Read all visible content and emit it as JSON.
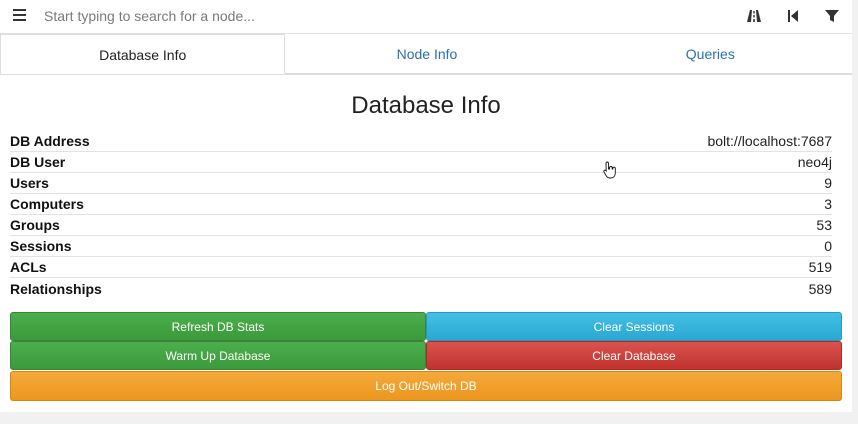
{
  "search": {
    "placeholder": "Start typing to search for a node..."
  },
  "toolbar": {
    "icons": [
      "menu-icon",
      "pathfinding-road-icon",
      "back-icon",
      "filter-icon"
    ]
  },
  "tabs": [
    {
      "label": "Database Info",
      "active": true
    },
    {
      "label": "Node Info",
      "active": false
    },
    {
      "label": "Queries",
      "active": false
    }
  ],
  "db_info": {
    "title": "Database Info",
    "rows": [
      {
        "label": "DB Address",
        "value": "bolt://localhost:7687"
      },
      {
        "label": "DB User",
        "value": "neo4j"
      },
      {
        "label": "Users",
        "value": "9"
      },
      {
        "label": "Computers",
        "value": "3"
      },
      {
        "label": "Groups",
        "value": "53"
      },
      {
        "label": "Sessions",
        "value": "0"
      },
      {
        "label": "ACLs",
        "value": "519"
      },
      {
        "label": "Relationships",
        "value": "589"
      }
    ]
  },
  "buttons": {
    "refresh": "Refresh DB Stats",
    "clear_sessions": "Clear Sessions",
    "warm_up": "Warm Up Database",
    "clear_database": "Clear Database",
    "logout": "Log Out/Switch DB"
  },
  "colors": {
    "link": "#2a6fb8",
    "green": "#3f9f3f",
    "blue": "#31b0d5",
    "red": "#c9302c",
    "orange": "#f0a030"
  }
}
